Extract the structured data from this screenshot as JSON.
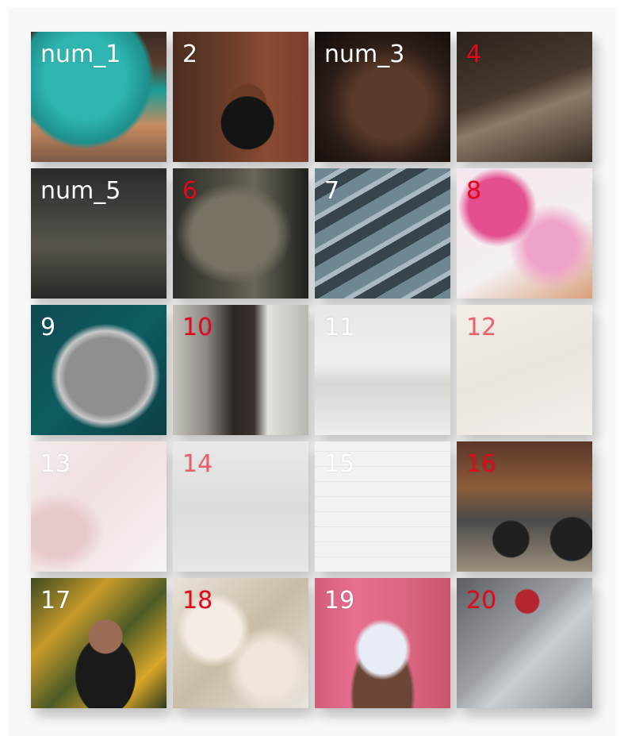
{
  "tiles": [
    {
      "label": "num_1"
    },
    {
      "label": "2"
    },
    {
      "label": "num_3"
    },
    {
      "label": "4"
    },
    {
      "label": "num_5"
    },
    {
      "label": "6"
    },
    {
      "label": "7"
    },
    {
      "label": "8"
    },
    {
      "label": "9"
    },
    {
      "label": "10"
    },
    {
      "label": "11"
    },
    {
      "label": "12"
    },
    {
      "label": "13"
    },
    {
      "label": "14"
    },
    {
      "label": "15"
    },
    {
      "label": "16"
    },
    {
      "label": "17"
    },
    {
      "label": "18"
    },
    {
      "label": "19"
    },
    {
      "label": "20"
    }
  ],
  "colors": {
    "label_white": "#ffffff",
    "label_red": "#e4081c",
    "panel_background": "#f8f8f8"
  }
}
